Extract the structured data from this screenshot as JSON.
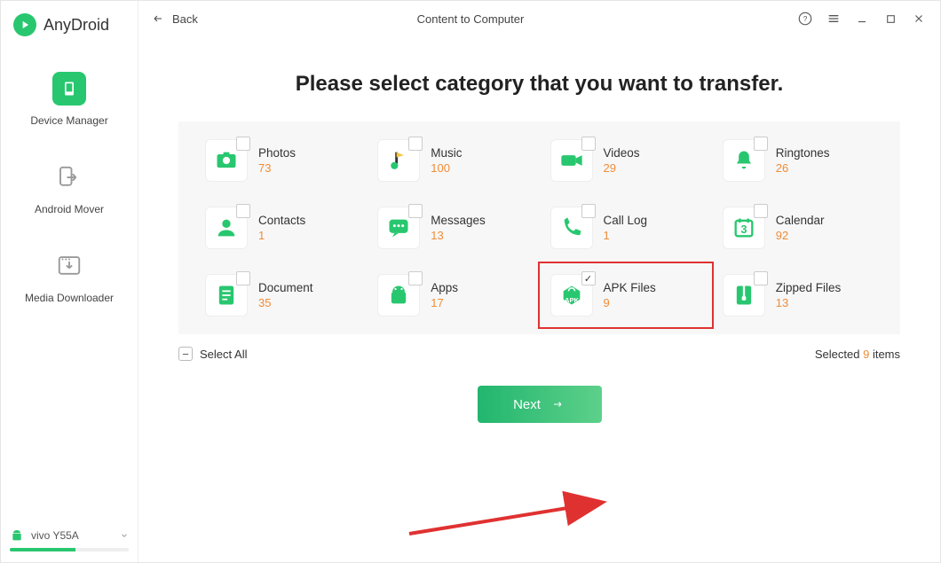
{
  "app": {
    "name": "AnyDroid",
    "title": "Content to Computer",
    "back": "Back"
  },
  "sidebar": {
    "items": [
      {
        "label": "Device Manager"
      },
      {
        "label": "Android Mover"
      },
      {
        "label": "Media Downloader"
      }
    ],
    "device": "vivo Y55A"
  },
  "headline": "Please select category that you want to transfer.",
  "categories": [
    {
      "name": "Photos",
      "count": "73",
      "icon": "photos",
      "checked": false
    },
    {
      "name": "Music",
      "count": "100",
      "icon": "music",
      "checked": false
    },
    {
      "name": "Videos",
      "count": "29",
      "icon": "videos",
      "checked": false
    },
    {
      "name": "Ringtones",
      "count": "26",
      "icon": "ringtones",
      "checked": false
    },
    {
      "name": "Contacts",
      "count": "1",
      "icon": "contacts",
      "checked": false
    },
    {
      "name": "Messages",
      "count": "13",
      "icon": "messages",
      "checked": false
    },
    {
      "name": "Call Log",
      "count": "1",
      "icon": "calllog",
      "checked": false
    },
    {
      "name": "Calendar",
      "count": "92",
      "icon": "calendar",
      "checked": false
    },
    {
      "name": "Document",
      "count": "35",
      "icon": "document",
      "checked": false
    },
    {
      "name": "Apps",
      "count": "17",
      "icon": "apps",
      "checked": false
    },
    {
      "name": "APK Files",
      "count": "9",
      "icon": "apk",
      "checked": true,
      "highlight": true
    },
    {
      "name": "Zipped Files",
      "count": "13",
      "icon": "zip",
      "checked": false
    }
  ],
  "selectAll": "Select All",
  "selected": {
    "prefix": "Selected ",
    "count": "9",
    "suffix": " items"
  },
  "next": "Next"
}
